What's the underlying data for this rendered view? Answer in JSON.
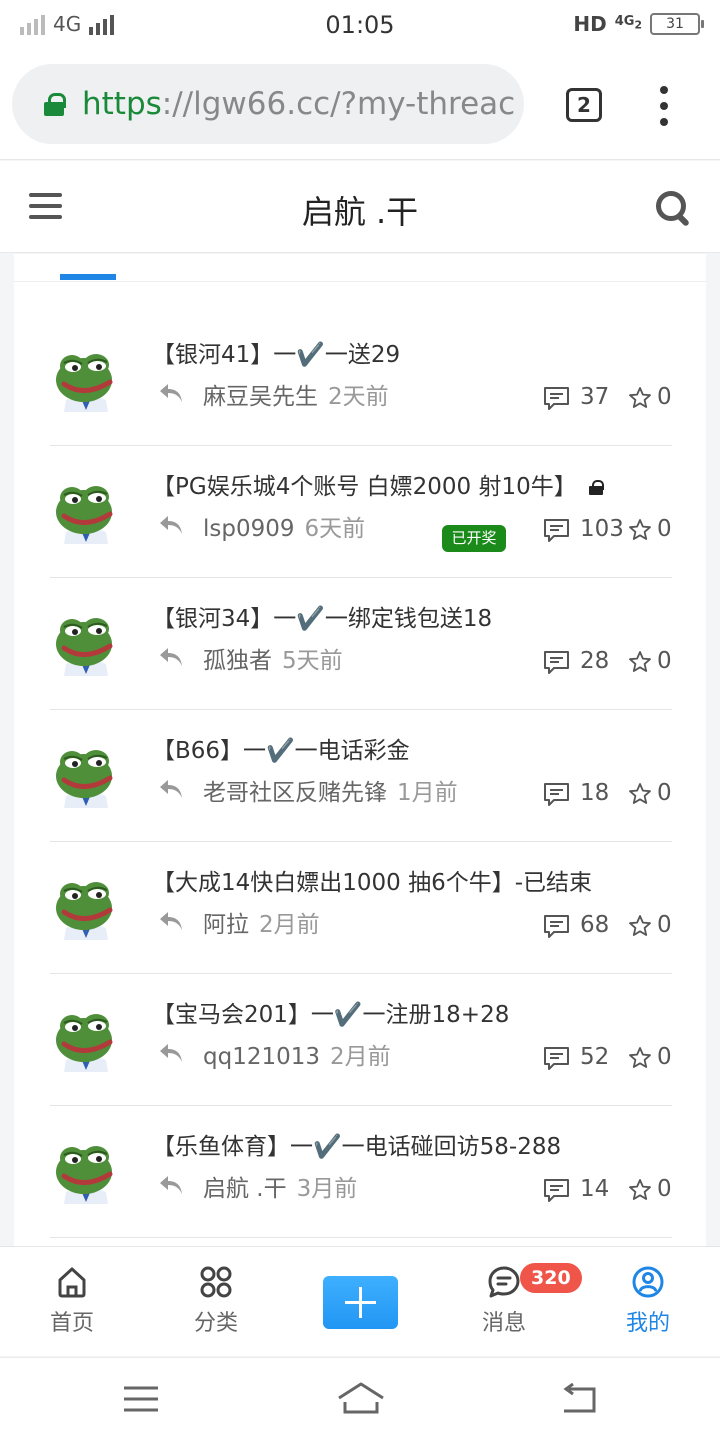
{
  "status_bar": {
    "network": "4G",
    "time": "01:05",
    "hd": "HD",
    "net_type": "4G",
    "net_sub": "2",
    "battery": "31"
  },
  "browser": {
    "url_scheme": "https",
    "url_rest": "://lgw66.cc/?my-threac",
    "tab_count": "2"
  },
  "header": {
    "title": "启航 .干"
  },
  "posts": [
    {
      "title": "【银河41】一✔️一送29",
      "author": "麻豆吴先生",
      "time": "2天前",
      "comments": "37",
      "stars": "0"
    },
    {
      "title": "【PG娱乐城4个账号 白嫖2000 射10牛】",
      "author": "lsp0909",
      "time": "6天前",
      "badge": "已开奖",
      "comments": "103",
      "stars": "0"
    },
    {
      "title": "【银河34】一✔️一绑定钱包送18",
      "author": "孤独者",
      "time": "5天前",
      "comments": "28",
      "stars": "0"
    },
    {
      "title": "【B66】一✔️一电话彩金",
      "author": "老哥社区反赌先锋",
      "time": "1月前",
      "comments": "18",
      "stars": "0"
    },
    {
      "title": "【大成14快白嫖出1000 抽6个牛】-已结束",
      "author": "阿拉",
      "time": "2月前",
      "comments": "68",
      "stars": "0"
    },
    {
      "title": "【宝马会201】一✔️一注册18+28",
      "author": "qq121013",
      "time": "2月前",
      "comments": "52",
      "stars": "0"
    },
    {
      "title": "【乐鱼体育】一✔️一电话碰回访58-288",
      "author": "启航 .干",
      "time": "3月前",
      "comments": "14",
      "stars": "0"
    }
  ],
  "tabbar": {
    "home": "首页",
    "category": "分类",
    "messages": "消息",
    "messages_badge": "320",
    "mine": "我的"
  },
  "colors": {
    "accent": "#1f86e6",
    "lock_green": "#1a8a3a",
    "badge_red": "#f0554a"
  }
}
